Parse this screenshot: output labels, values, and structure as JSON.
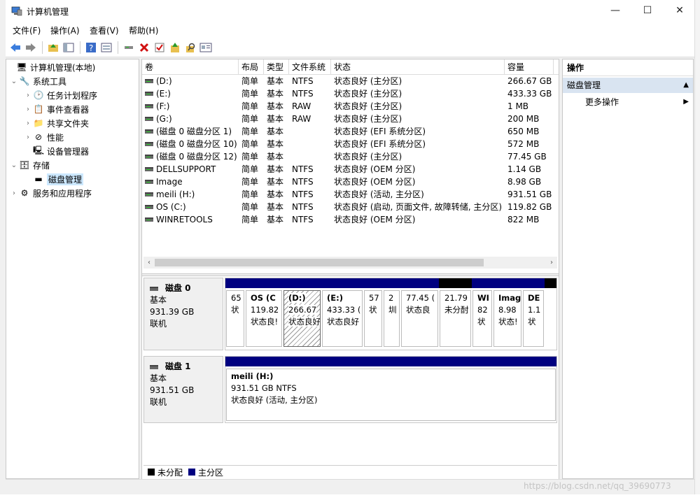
{
  "window": {
    "title": "计算机管理",
    "controls": {
      "minimize": "—",
      "maximize": "☐",
      "close": "✕"
    }
  },
  "menu": [
    "文件(F)",
    "操作(A)",
    "查看(V)",
    "帮助(H)"
  ],
  "toolbar": {
    "icons": [
      "back-icon",
      "forward-icon",
      "up-folder-icon",
      "show-tree-icon",
      "help-icon",
      "properties-icon",
      "connect-icon",
      "delete-icon",
      "check-icon",
      "export-icon",
      "search-icon",
      "console-icon"
    ]
  },
  "tree": [
    {
      "label": "计算机管理(本地)",
      "chev": "",
      "icon": "computer-icon",
      "glyph": "🖥"
    },
    {
      "label": "系统工具",
      "chev": "⌄",
      "icon": "tools-icon",
      "glyph": "🔧"
    },
    {
      "label": "任务计划程序",
      "chev": "›",
      "icon": "clock-icon",
      "glyph": "🕑"
    },
    {
      "label": "事件查看器",
      "chev": "›",
      "icon": "event-viewer-icon",
      "glyph": "📋"
    },
    {
      "label": "共享文件夹",
      "chev": "›",
      "icon": "shared-folder-icon",
      "glyph": "📁"
    },
    {
      "label": "性能",
      "chev": "›",
      "icon": "performance-icon",
      "glyph": "⊘"
    },
    {
      "label": "设备管理器",
      "chev": "",
      "icon": "device-manager-icon",
      "glyph": "🖳"
    },
    {
      "label": "存储",
      "chev": "⌄",
      "icon": "storage-icon",
      "glyph": "🗄"
    },
    {
      "label": "磁盘管理",
      "chev": "",
      "icon": "disk-management-icon",
      "glyph": "▬"
    },
    {
      "label": "服务和应用程序",
      "chev": "›",
      "icon": "services-icon",
      "glyph": "⚙"
    }
  ],
  "volume_table": {
    "headers": [
      "卷",
      "布局",
      "类型",
      "文件系统",
      "状态",
      "容量"
    ],
    "rows": [
      [
        "(D:)",
        "简单",
        "基本",
        "NTFS",
        "状态良好 (主分区)",
        "266.67 GB"
      ],
      [
        "(E:)",
        "简单",
        "基本",
        "NTFS",
        "状态良好 (主分区)",
        "433.33 GB"
      ],
      [
        "(F:)",
        "简单",
        "基本",
        "RAW",
        "状态良好 (主分区)",
        "1 MB"
      ],
      [
        "(G:)",
        "简单",
        "基本",
        "RAW",
        "状态良好 (主分区)",
        "200 MB"
      ],
      [
        "(磁盘 0 磁盘分区 1)",
        "简单",
        "基本",
        "",
        "状态良好 (EFI 系统分区)",
        "650 MB"
      ],
      [
        "(磁盘 0 磁盘分区 10)",
        "简单",
        "基本",
        "",
        "状态良好 (EFI 系统分区)",
        "572 MB"
      ],
      [
        "(磁盘 0 磁盘分区 12)",
        "简单",
        "基本",
        "",
        "状态良好 (主分区)",
        "77.45 GB"
      ],
      [
        "DELLSUPPORT",
        "简单",
        "基本",
        "NTFS",
        "状态良好 (OEM 分区)",
        "1.14 GB"
      ],
      [
        "Image",
        "简单",
        "基本",
        "NTFS",
        "状态良好 (OEM 分区)",
        "8.98 GB"
      ],
      [
        "meili (H:)",
        "简单",
        "基本",
        "NTFS",
        "状态良好 (活动, 主分区)",
        "931.51 GB"
      ],
      [
        "OS (C:)",
        "简单",
        "基本",
        "NTFS",
        "状态良好 (启动, 页面文件, 故障转储, 主分区)",
        "119.82 GB"
      ],
      [
        "WINRETOOLS",
        "简单",
        "基本",
        "NTFS",
        "状态良好 (OEM 分区)",
        "822 MB"
      ]
    ]
  },
  "disks": [
    {
      "name": "磁盘 0",
      "type": "基本",
      "size": "931.39 GB",
      "status": "联机",
      "partitions": [
        {
          "lines": [
            "65",
            "状"
          ],
          "unalloc": false,
          "bold": false,
          "hatched": false
        },
        {
          "lines": [
            "OS  (C",
            "119.82",
            "状态良!"
          ],
          "unalloc": false,
          "bold": true,
          "hatched": false
        },
        {
          "lines": [
            "(D:)",
            "266.67",
            "状态良好"
          ],
          "unalloc": false,
          "bold": true,
          "hatched": true
        },
        {
          "lines": [
            "(E:)",
            "433.33 (",
            "状态良好"
          ],
          "unalloc": false,
          "bold": true,
          "hatched": false
        },
        {
          "lines": [
            "57",
            "状"
          ],
          "unalloc": false,
          "bold": false,
          "hatched": false
        },
        {
          "lines": [
            "2",
            "圳"
          ],
          "unalloc": false,
          "bold": false,
          "hatched": false
        },
        {
          "lines": [
            "77.45 (",
            "状态良"
          ],
          "unalloc": false,
          "bold": false,
          "hatched": false
        },
        {
          "lines": [
            "21.79",
            "未分酎"
          ],
          "unalloc": true,
          "bold": false,
          "hatched": false
        },
        {
          "lines": [
            "WI",
            "82",
            "状"
          ],
          "unalloc": false,
          "bold": true,
          "hatched": false
        },
        {
          "lines": [
            "Imag",
            "8.98",
            "状态!"
          ],
          "unalloc": false,
          "bold": true,
          "hatched": false
        },
        {
          "lines": [
            "DE",
            "1.1",
            "状"
          ],
          "unalloc": false,
          "bold": true,
          "hatched": false
        },
        {
          "lines": [],
          "unalloc": true,
          "bold": false,
          "hatched": false
        }
      ]
    },
    {
      "name": "磁盘 1",
      "type": "基本",
      "size": "931.51 GB",
      "status": "联机",
      "partitions": [
        {
          "lines": [
            "meili  (H:)",
            "931.51 GB NTFS",
            "状态良好 (活动, 主分区)"
          ],
          "unalloc": false,
          "bold": true,
          "hatched": false
        }
      ]
    }
  ],
  "legend": [
    {
      "label": "未分配",
      "color": "#000000"
    },
    {
      "label": "主分区",
      "color": "#000080"
    }
  ],
  "actions": {
    "header": "操作",
    "section": "磁盘管理",
    "more": "更多操作"
  },
  "watermark": "https://blog.csdn.net/qq_39690773"
}
